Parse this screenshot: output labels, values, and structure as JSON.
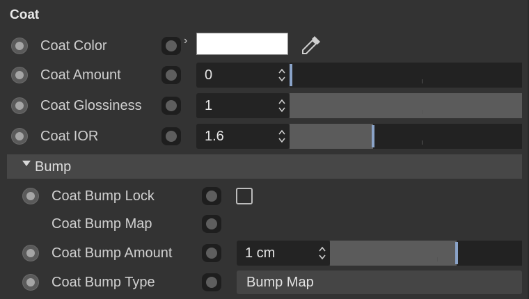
{
  "section": {
    "title": "Coat"
  },
  "rows": {
    "coat_color": {
      "label": "Coat Color",
      "swatch": "#ffffff"
    },
    "coat_amount": {
      "label": "Coat Amount",
      "value": "0",
      "level": 0.0
    },
    "coat_glossiness": {
      "label": "Coat Glossiness",
      "value": "1",
      "level": 1.0
    },
    "coat_ior": {
      "label": "Coat IOR",
      "value": "1.6",
      "level": 0.36
    }
  },
  "bump": {
    "header": "Bump",
    "lock": {
      "label": "Coat Bump Lock",
      "checked": false
    },
    "map": {
      "label": "Coat Bump Map"
    },
    "amount": {
      "label": "Coat Bump Amount",
      "value": "1 cm",
      "level": 0.66
    },
    "type": {
      "label": "Coat Bump Type",
      "value": "Bump Map"
    }
  },
  "colors": {
    "background": "#333333",
    "field": "#232323",
    "slider_fill": "#5b5b5b",
    "slider_handle": "#8aa3c8"
  },
  "icons": {
    "animate": "animate-dot-icon",
    "keyframe": "keyframe-icon",
    "expand": "chevron-right-icon",
    "picker": "eyedropper-icon",
    "spinner": "spinner-arrows-icon",
    "collapse": "triangle-down-icon"
  }
}
